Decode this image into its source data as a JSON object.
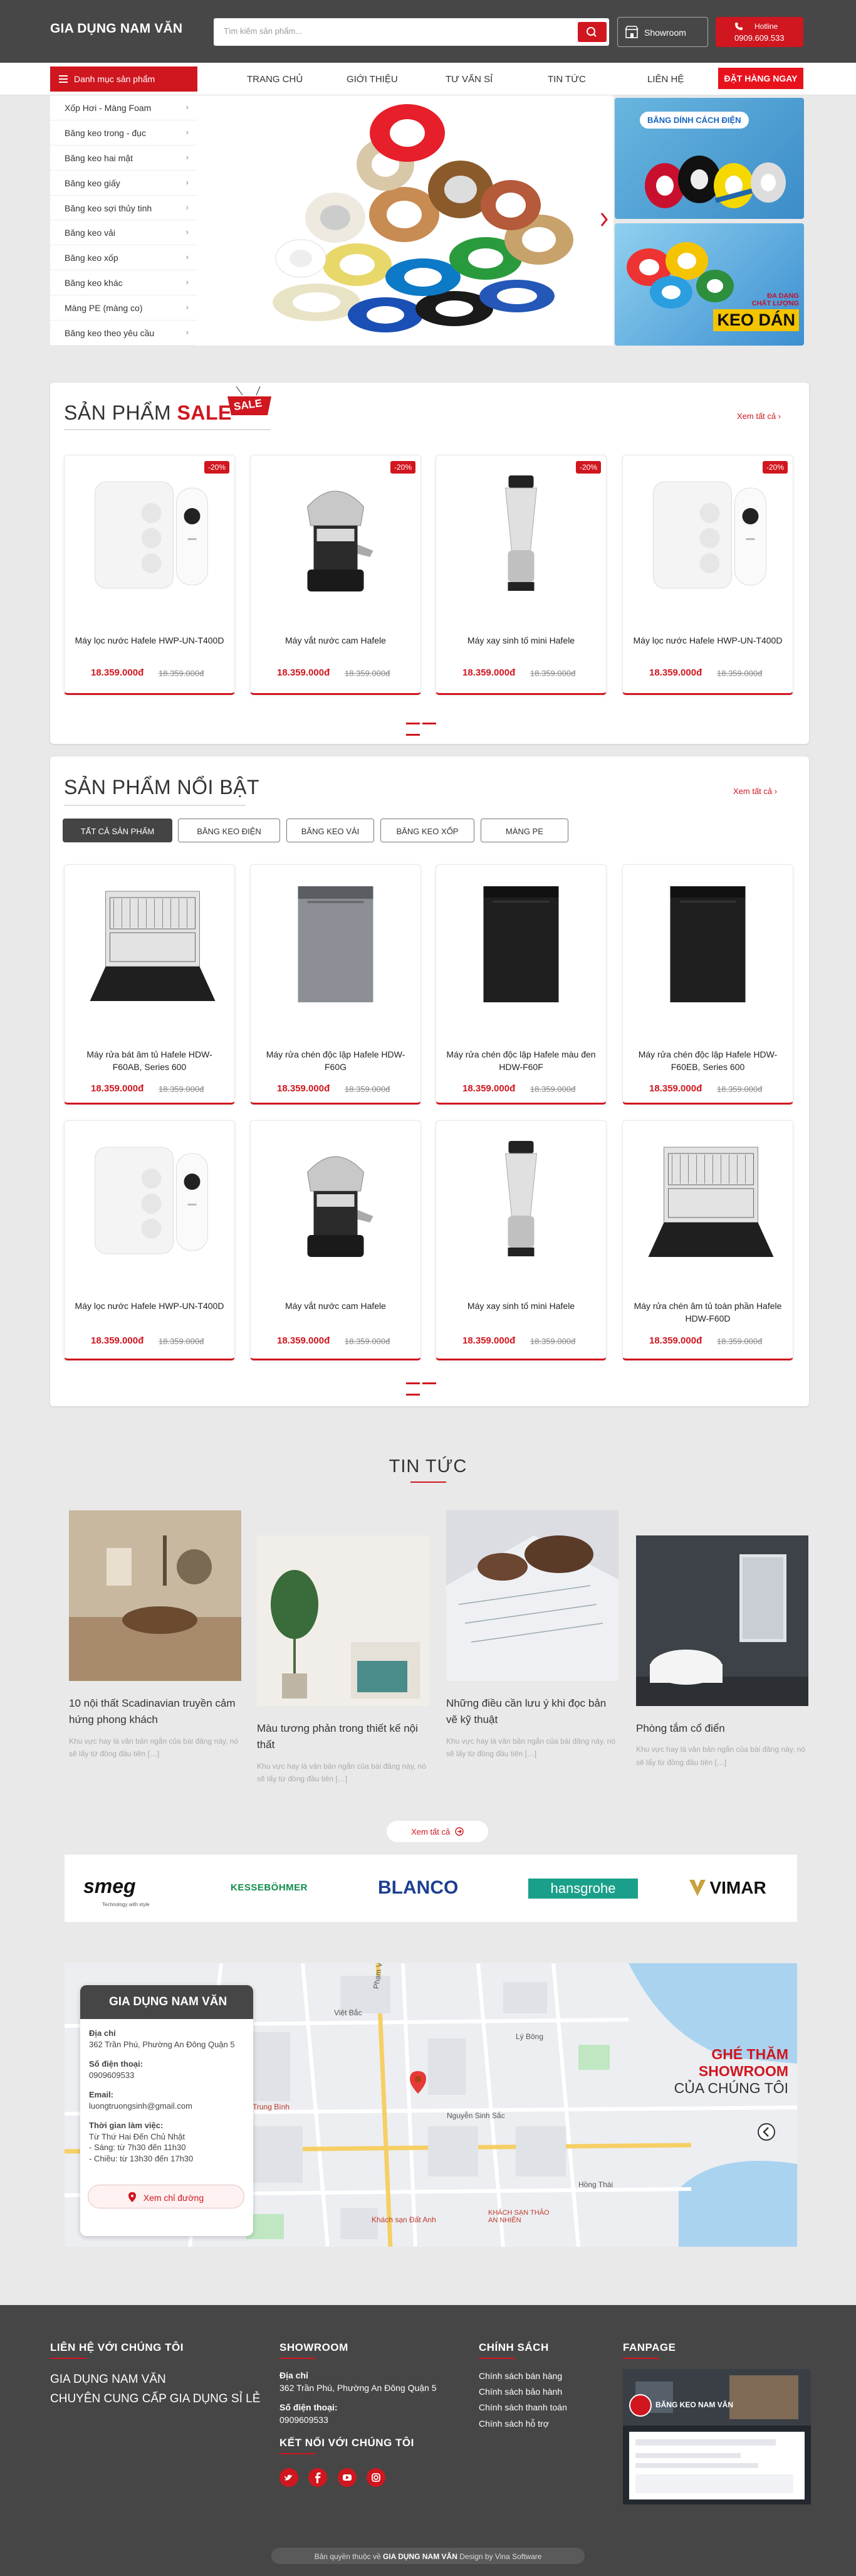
{
  "header": {
    "logo": "GIA DỤNG NAM VĂN",
    "search_placeholder": "Tìm kiếm sản phẩm...",
    "showroom": "Showroom",
    "hotline_label": "Hotline",
    "hotline_number": "0909.609.533"
  },
  "nav": {
    "category_button": "Danh mục sản phẩm",
    "links": [
      "TRANG CHỦ",
      "GIỚI THIỆU",
      "TƯ VẤN SỈ",
      "TIN TỨC",
      "LIÊN HỆ"
    ],
    "order_button": "ĐẶT HÀNG NGAY"
  },
  "sidebar": {
    "items": [
      "Xốp Hơi - Màng Foam",
      "Băng keo trong - đục",
      "Băng keo hai mặt",
      "Băng keo giấy",
      "Băng keo sợi thủy tinh",
      "Băng keo vải",
      "Băng keo xốp",
      "Băng keo khác",
      "Màng PE (màng co)",
      "Băng keo theo yêu cầu"
    ]
  },
  "banners": {
    "a_title": "BĂNG DÍNH CÁCH ĐIỆN",
    "b_line1": "ĐA DẠNG",
    "b_line2": "CHẤT LƯỢNG",
    "b_line3": "KEO DÁN"
  },
  "sale": {
    "title_a": "SẢN PHẨM",
    "title_b": "SALE",
    "tag": "SALE",
    "see_all": "Xem tất cả",
    "products": [
      {
        "name": "Máy lọc nước Hafele HWP-UN-T400D",
        "price": "18.359.000đ",
        "old": "18.359.000đ",
        "badge": "-20%",
        "kind": "purifier"
      },
      {
        "name": "Máy vắt nước cam Hafele",
        "price": "18.359.000đ",
        "old": "18.359.000đ",
        "badge": "-20%",
        "kind": "juicer"
      },
      {
        "name": "Máy xay sinh tố mini Hafele",
        "price": "18.359.000đ",
        "old": "18.359.000đ",
        "badge": "-20%",
        "kind": "blender"
      },
      {
        "name": "Máy lọc nước Hafele HWP-UN-T400D",
        "price": "18.359.000đ",
        "old": "18.359.000đ",
        "badge": "-20%",
        "kind": "purifier"
      }
    ]
  },
  "featured": {
    "title": "SẢN PHẨM NỔI BẬT",
    "see_all": "Xem tất cả",
    "tabs": [
      "TẤT CẢ SẢN PHẨM",
      "BĂNG KEO ĐIỆN",
      "BĂNG KEO VẢI",
      "BĂNG KEO XỐP",
      "MÀNG PE"
    ],
    "products": [
      {
        "name": "Máy rửa bát âm tủ Hafele HDW-F60AB, Series 600",
        "price": "18.359.000đ",
        "old": "18.359.000đ",
        "kind": "dishopen"
      },
      {
        "name": "Máy rửa chén độc lập Hafele HDW-F60G",
        "price": "18.359.000đ",
        "old": "18.359.000đ",
        "kind": "dishsilver"
      },
      {
        "name": "Máy rửa chén độc lập Hafele màu đen HDW-F60F",
        "price": "18.359.000đ",
        "old": "18.359.000đ",
        "kind": "dishblack"
      },
      {
        "name": "Máy rửa chén độc lập Hafele HDW-F60EB, Series 600",
        "price": "18.359.000đ",
        "old": "18.359.000đ",
        "kind": "dishblack2"
      },
      {
        "name": "Máy lọc nước Hafele HWP-UN-T400D",
        "price": "18.359.000đ",
        "old": "18.359.000đ",
        "kind": "purifier"
      },
      {
        "name": "Máy vắt nước cam Hafele",
        "price": "18.359.000đ",
        "old": "18.359.000đ",
        "kind": "juicer"
      },
      {
        "name": "Máy xay sinh tố mini Hafele",
        "price": "18.359.000đ",
        "old": "18.359.000đ",
        "kind": "blender"
      },
      {
        "name": "Máy rửa chén âm tủ toàn phần Hafele HDW-F60D",
        "price": "18.359.000đ",
        "old": "18.359.000đ",
        "kind": "dishopen2"
      }
    ]
  },
  "news": {
    "title": "TIN TỨC",
    "see_all": "Xem tất cả",
    "items": [
      {
        "title": "10 nội thất Scadinavian truyền cảm hứng phong khách",
        "excerpt": "Khu vực hay là văn bản ngắn của bài đăng này, nó sẽ lấy từ đồng đầu tiên […]"
      },
      {
        "title": "Màu tương phản trong thiết kế nội thất",
        "excerpt": "Khu vực hay là văn bản ngắn của bài đăng này, nó sẽ lấy từ đồng đầu tiên […]"
      },
      {
        "title": "Những điều cần lưu ý khi đọc bản vẽ kỹ thuật",
        "excerpt": "Khu vực hay là văn bản ngắn của bài đăng này, nó sẽ lấy từ đồng đầu tiên […]"
      },
      {
        "title": "Phòng tắm cổ điển",
        "excerpt": "Khu vực hay là văn bản ngắn của bài đăng này, nó sẽ lấy từ đồng đầu tiên […]"
      }
    ]
  },
  "brands": {
    "smeg": "smeg",
    "smeg_sub": "Technology with style",
    "kessebohmer": "KESSEBÖHMER",
    "blanco": "BLANCO",
    "hansgrohe": "hansgrohe",
    "vimar": "VIMAR"
  },
  "map": {
    "card_title": "GIA DỤNG NAM VĂN",
    "address_label": "Địa chỉ",
    "address": "362 Trần Phú, Phường An Đông Quận 5",
    "phone_label": "Số điện thoại:",
    "phone": "0909609533",
    "email_label": "Email:",
    "email": "luongtruongsinh@gmail.com",
    "hours_label": "Thời gian làm việc:",
    "hours": [
      "Từ Thứ Hai Đến Chủ Nhật",
      "- Sáng: từ 7h30 đến 11h30",
      "- Chiều: từ 13h30 đến 17h30"
    ],
    "directions": "Xem chỉ đường",
    "visit_line1": "GHÉ THĂM",
    "visit_line2": "SHOWROOM",
    "visit_line3": "CỦA CHÚNG TÔI",
    "streets": [
      "Phạm Văn Đồng",
      "Nguyễn Sinh Sắc",
      "Hồng Thái",
      "Việt Bắc",
      "Lý Bông"
    ],
    "place1": "Khách sạn Đất Anh",
    "place2": "KHÁCH SẠN THẢO AN NHIÊN",
    "place3": "Trung Bình"
  },
  "footer": {
    "contact_h": "LIÊN HỆ VỚI CHÚNG TÔI",
    "contact_1": "GIA DỤNG NAM VĂN",
    "contact_2": "CHUYÊN CUNG CẤP GIA DỤNG SỈ LẺ",
    "showroom_h": "SHOWROOM",
    "addr_label": "Địa chỉ",
    "addr": "362 Trần Phú, Phường An Đông Quận 5",
    "phone_label": "Số điện thoại:",
    "phone": "0909609533",
    "connect_h": "KẾT NỐI VỚI CHÚNG TÔI",
    "policy_h": "CHÍNH SÁCH",
    "policies": [
      "Chính sách bán hàng",
      "Chính sách bảo hành",
      "Chính sách thanh toán",
      "Chính sách hỗ trợ"
    ],
    "fanpage_h": "FANPAGE",
    "fanpage_name": "BĂNG KEO NAM VĂN",
    "copyright_a": "Bản quyền thuộc về",
    "copyright_b": "GIA DỤNG NAM VĂN",
    "copyright_c": "Design by Vina Software"
  },
  "colors": {
    "brand_red": "#d0161f",
    "header_gray": "#474747",
    "footer_gray": "#464646"
  }
}
